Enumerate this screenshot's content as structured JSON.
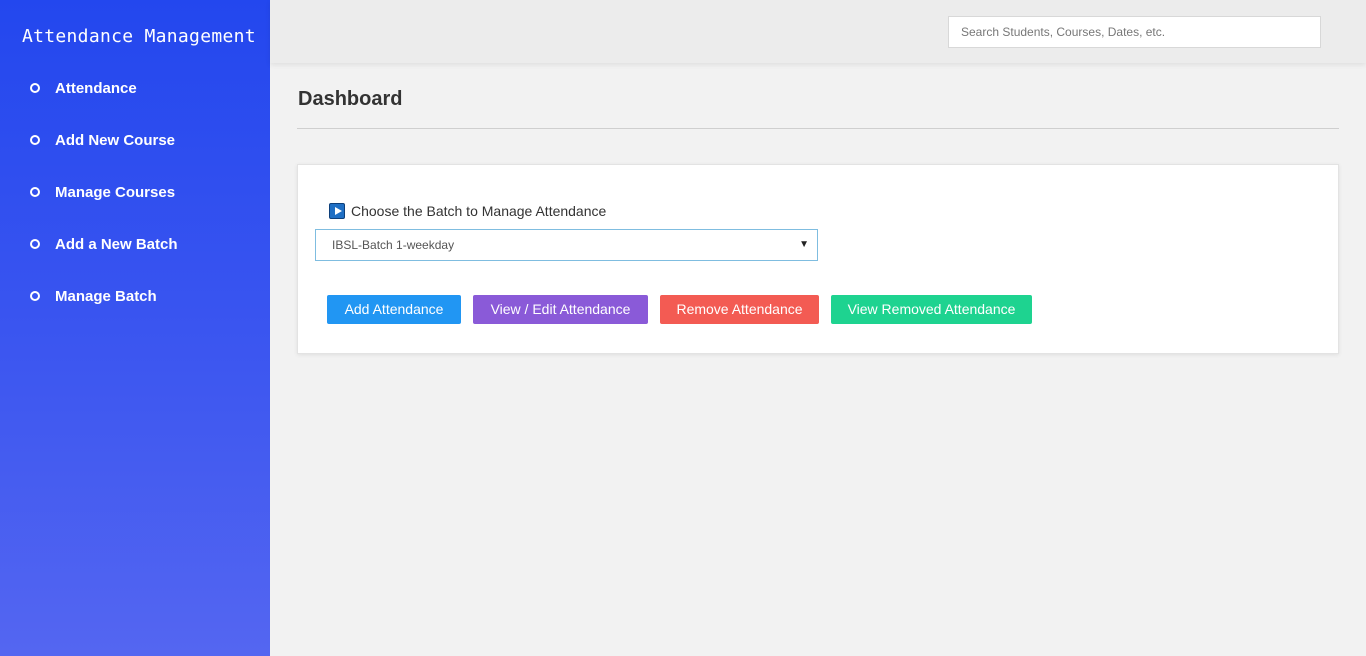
{
  "sidebar": {
    "brand": "Attendance Management",
    "items": [
      {
        "label": "Attendance"
      },
      {
        "label": "Add New Course"
      },
      {
        "label": "Manage Courses"
      },
      {
        "label": "Add a New Batch"
      },
      {
        "label": "Manage Batch"
      }
    ],
    "colors": {
      "gradient_top": "#2347ee",
      "gradient_bottom": "#5466f1"
    }
  },
  "topbar": {
    "search_placeholder": "Search Students, Courses, Dates, etc."
  },
  "main": {
    "title": "Dashboard",
    "card": {
      "label": "Choose the Batch to Manage Attendance",
      "label_icon": "play-icon",
      "batch_select": {
        "selected": "IBSL-Batch 1-weekday"
      },
      "buttons": {
        "add": {
          "label": "Add Attendance",
          "color": "#2196f3"
        },
        "view_edit": {
          "label": "View / Edit Attendance",
          "color": "#8a5ad8"
        },
        "remove": {
          "label": "Remove Attendance",
          "color": "#f35b53"
        },
        "view_removed": {
          "label": "View Removed Attendance",
          "color": "#1ed390"
        }
      }
    }
  }
}
